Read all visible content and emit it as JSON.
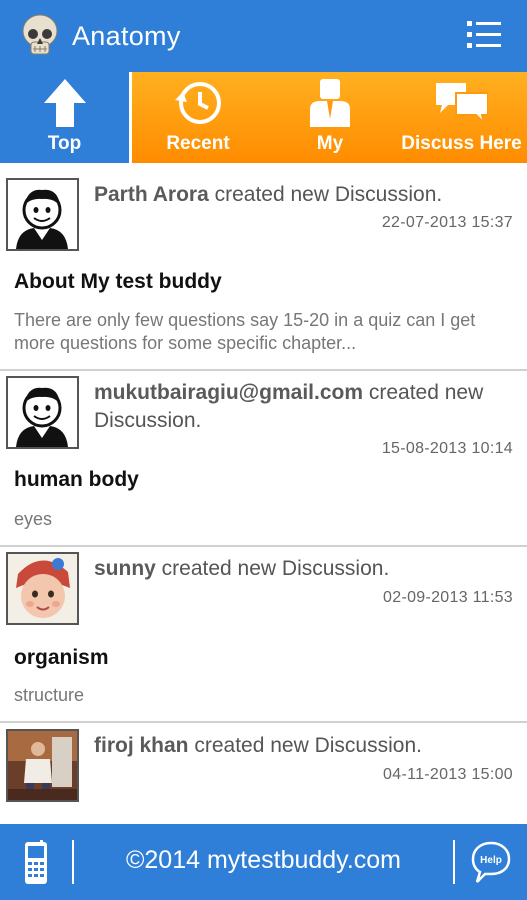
{
  "header": {
    "title": "Anatomy",
    "logo_icon": "skull-icon",
    "menu_icon": "list-menu-icon"
  },
  "tabs": [
    {
      "label": "Top",
      "icon": "arrow-up-icon",
      "active": true
    },
    {
      "label": "Recent",
      "icon": "history-clock-icon",
      "active": false
    },
    {
      "label": "My",
      "icon": "user-icon",
      "active": false
    },
    {
      "label": "Discuss Here",
      "icon": "chat-bubbles-icon",
      "active": false
    }
  ],
  "feed": [
    {
      "user": "Parth Arora",
      "action": " created new Discussion.",
      "timestamp": "22-07-2013 15:37",
      "title": "About My test buddy",
      "description": "There are only few questions say 15-20 in a quiz can I get more questions for some specific chapter..."
    },
    {
      "user": "mukutbairagiu@gmail.com",
      "action": " created new Discussion.",
      "timestamp": "15-08-2013 10:14",
      "title": "human body",
      "description": "eyes"
    },
    {
      "user": "sunny",
      "action": " created new Discussion.",
      "timestamp": "02-09-2013 11:53",
      "title": "organism",
      "description": "structure"
    },
    {
      "user": "firoj khan",
      "action": " created new Discussion.",
      "timestamp": "04-11-2013 15:00",
      "title": "",
      "description": ""
    }
  ],
  "footer": {
    "copyright": "©2014 mytestbuddy.com",
    "help_label": "Help",
    "phone_icon": "mobile-phone-icon"
  },
  "colors": {
    "primary": "#2f7fd8",
    "tab_orange": "#ff9a10"
  }
}
